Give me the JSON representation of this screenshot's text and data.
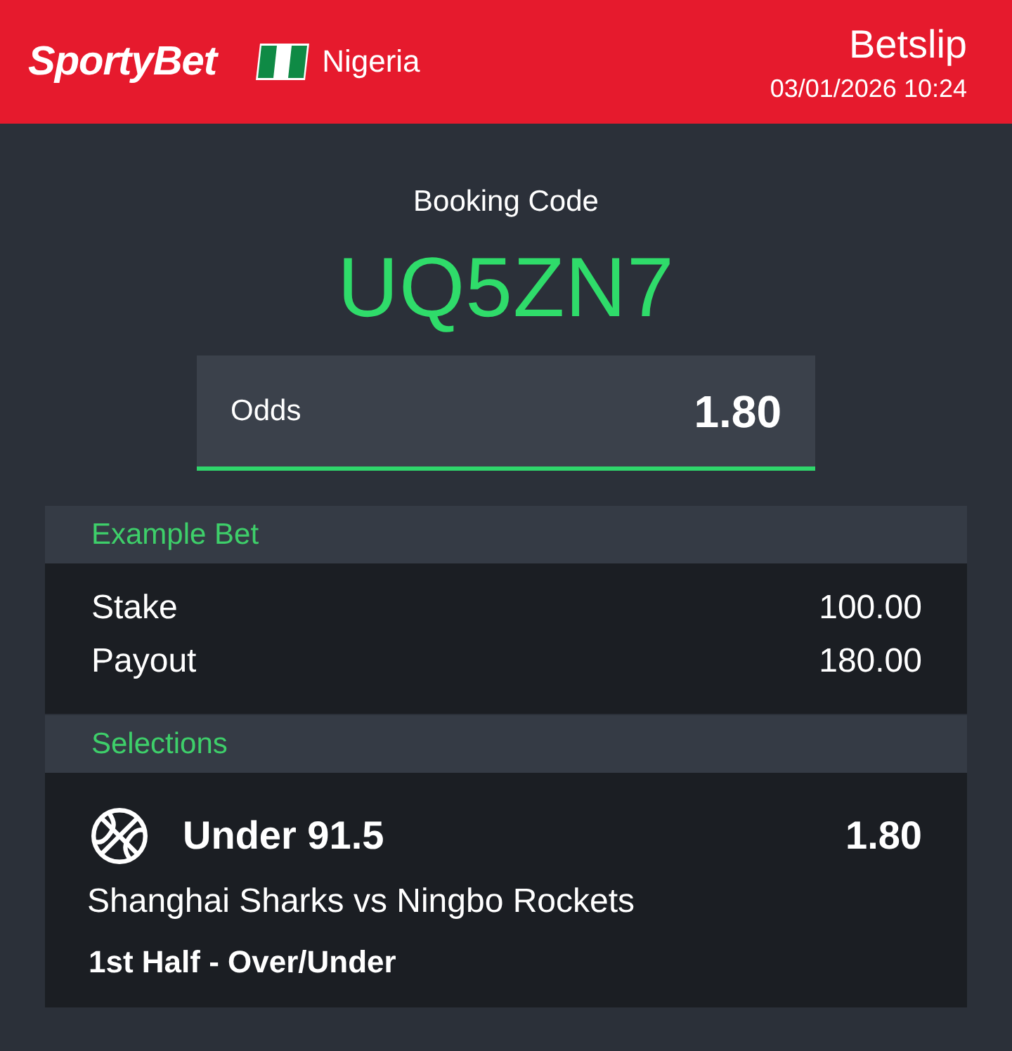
{
  "header": {
    "logo": "SportyBet",
    "country": "Nigeria",
    "title": "Betslip",
    "datetime": "03/01/2026 10:24"
  },
  "booking": {
    "label": "Booking Code",
    "code": "UQ5ZN7"
  },
  "odds": {
    "label": "Odds",
    "value": "1.80"
  },
  "example_bet": {
    "title": "Example Bet",
    "rows": [
      {
        "label": "Stake",
        "value": "100.00"
      },
      {
        "label": "Payout",
        "value": "180.00"
      }
    ]
  },
  "selections": {
    "title": "Selections",
    "items": [
      {
        "pick": "Under 91.5",
        "odds": "1.80",
        "match": "Shanghai Sharks vs Ningbo Rockets",
        "market": "1st Half - Over/Under"
      }
    ]
  }
}
